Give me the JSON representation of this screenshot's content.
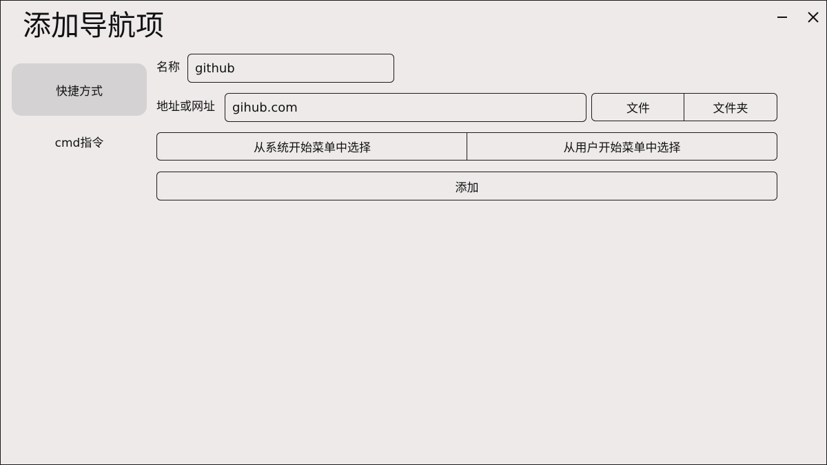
{
  "window": {
    "title": "添加导航项"
  },
  "sidebar": {
    "items": [
      {
        "label": "快捷方式",
        "active": true
      },
      {
        "label": "cmd指令",
        "active": false
      }
    ]
  },
  "form": {
    "name_label": "名称",
    "name_value": "github",
    "address_label": "地址或网址",
    "address_value": "gihub.com",
    "file_button": "文件",
    "folder_button": "文件夹",
    "system_start_menu_button": "从系统开始菜单中选择",
    "user_start_menu_button": "从用户开始菜单中选择",
    "add_button": "添加"
  },
  "icons": {
    "minimize": "minimize-icon",
    "close": "close-icon"
  },
  "colors": {
    "background": "#eeeaea",
    "active_sidebar": "#d4d2d2",
    "border": "#1a1a1a"
  }
}
